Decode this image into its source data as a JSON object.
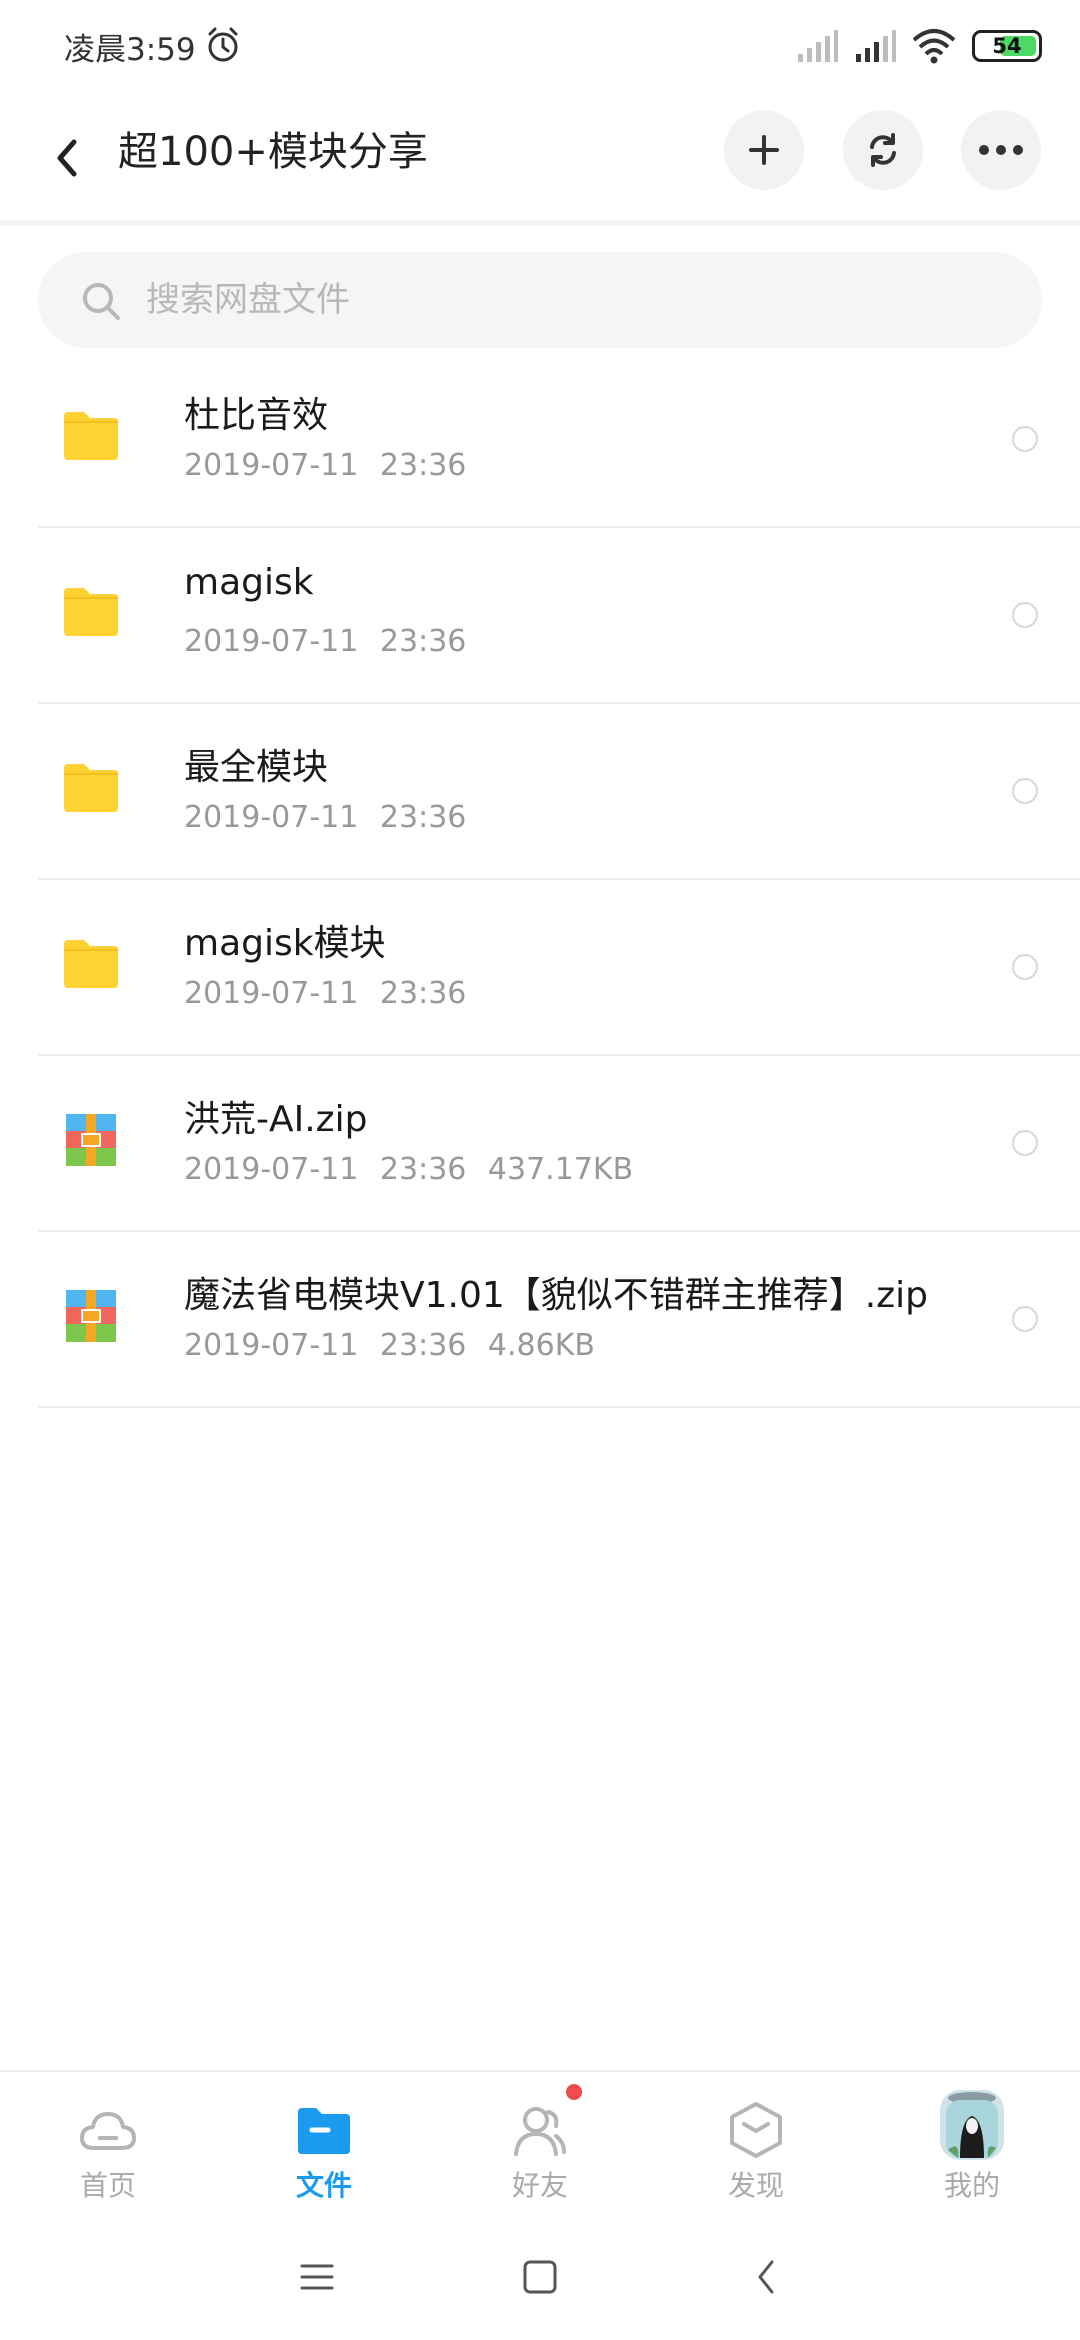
{
  "status": {
    "time": "凌晨3:59",
    "battery": "54"
  },
  "header": {
    "title": "超100+模块分享"
  },
  "search": {
    "placeholder": "搜索网盘文件"
  },
  "files": [
    {
      "name": "杜比音效",
      "date": "2019-07-11",
      "time": "23:36",
      "size": "",
      "type": "folder"
    },
    {
      "name": "magisk",
      "date": "2019-07-11",
      "time": "23:36",
      "size": "",
      "type": "folder"
    },
    {
      "name": "最全模块",
      "date": "2019-07-11",
      "time": "23:36",
      "size": "",
      "type": "folder"
    },
    {
      "name": "magisk模块",
      "date": "2019-07-11",
      "time": "23:36",
      "size": "",
      "type": "folder"
    },
    {
      "name": "洪荒-AI.zip",
      "date": "2019-07-11",
      "time": "23:36",
      "size": "437.17KB",
      "type": "zip"
    },
    {
      "name": "魔法省电模块V1.01【貌似不错群主推荐】.zip",
      "date": "2019-07-11",
      "time": "23:36",
      "size": "4.86KB",
      "type": "zip"
    }
  ],
  "nav": {
    "home": "首页",
    "files": "文件",
    "friends": "好友",
    "discover": "发现",
    "mine": "我的"
  },
  "colors": {
    "accent": "#1b9bf0",
    "folder": "#ffd234",
    "badge": "#f24b4b"
  }
}
